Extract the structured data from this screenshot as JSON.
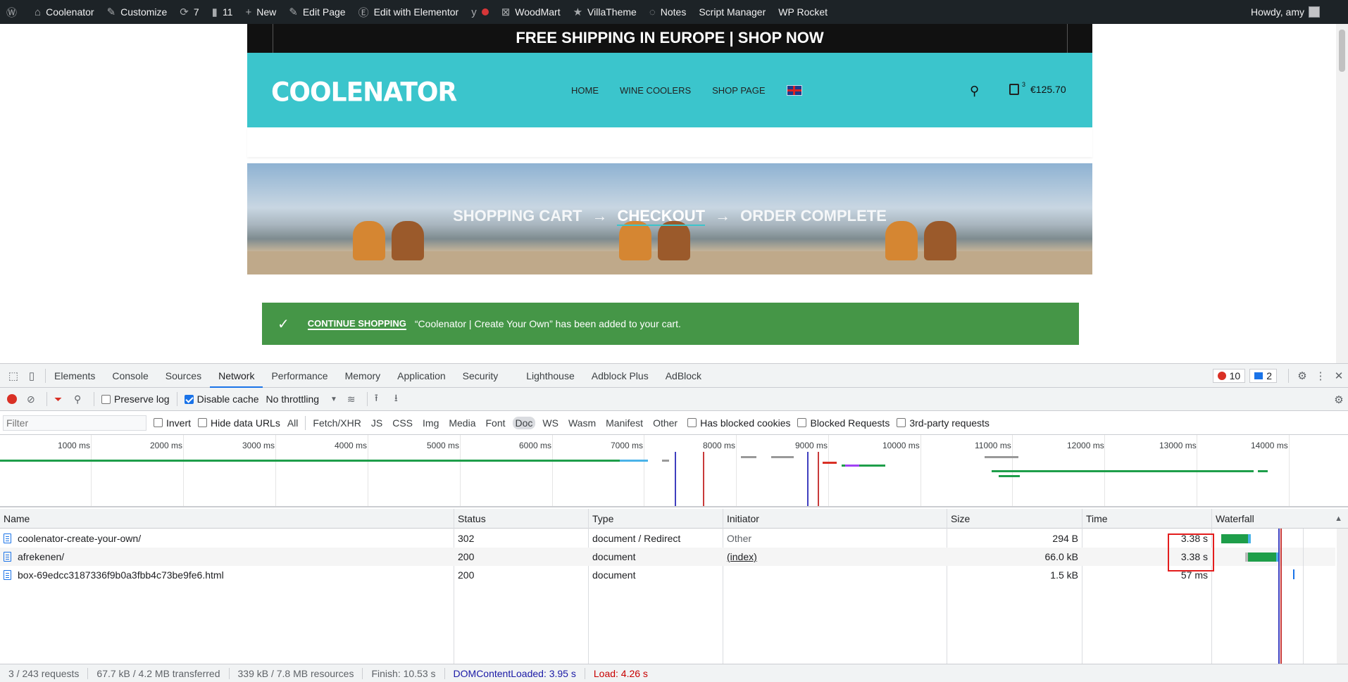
{
  "wp_bar": {
    "site_name": "Coolenator",
    "customize": "Customize",
    "updates": "7",
    "comments": "11",
    "new": "New",
    "edit_page": "Edit Page",
    "edit_elementor": "Edit with Elementor",
    "woodmart": "WoodMart",
    "villatheme": "VillaTheme",
    "notes": "Notes",
    "script_manager": "Script Manager",
    "wp_rocket": "WP Rocket",
    "howdy": "Howdy, amy"
  },
  "site": {
    "promo": "FREE SHIPPING IN EUROPE | SHOP NOW",
    "logo": "COOLENATOR",
    "nav": [
      "HOME",
      "WINE COOLERS",
      "SHOP PAGE"
    ],
    "cart_count": "3",
    "cart_total": "€125.70",
    "breadcrumbs": [
      "SHOPPING CART",
      "CHECKOUT",
      "ORDER COMPLETE"
    ],
    "notice_link": "CONTINUE SHOPPING",
    "notice_text": "“Coolenator | Create Your Own” has been added to your cart."
  },
  "devtools": {
    "tabs": [
      "Elements",
      "Console",
      "Sources",
      "Network",
      "Performance",
      "Memory",
      "Application",
      "Security",
      "Lighthouse",
      "Adblock Plus",
      "AdBlock"
    ],
    "active_tab": "Network",
    "errors": "10",
    "messages": "2",
    "toolbar": {
      "preserve_log": "Preserve log",
      "disable_cache": "Disable cache",
      "throttling": "No throttling"
    },
    "filter": {
      "placeholder": "Filter",
      "invert": "Invert",
      "hide_data_urls": "Hide data URLs",
      "types": [
        "All",
        "Fetch/XHR",
        "JS",
        "CSS",
        "Img",
        "Media",
        "Font",
        "Doc",
        "WS",
        "Wasm",
        "Manifest",
        "Other"
      ],
      "selected_type": "Doc",
      "has_blocked_cookies": "Has blocked cookies",
      "blocked_requests": "Blocked Requests",
      "third_party": "3rd-party requests"
    },
    "overview_ticks": [
      "1000 ms",
      "2000 ms",
      "3000 ms",
      "4000 ms",
      "5000 ms",
      "6000 ms",
      "7000 ms",
      "8000 ms",
      "9000 ms",
      "10000 ms",
      "11000 ms",
      "12000 ms",
      "13000 ms",
      "14000 ms"
    ],
    "columns": [
      "Name",
      "Status",
      "Type",
      "Initiator",
      "Size",
      "Time",
      "Waterfall"
    ],
    "rows": [
      {
        "name": "coolenator-create-your-own/",
        "status": "302",
        "type": "document / Redirect",
        "initiator": "Other",
        "size": "294 B",
        "time": "3.38 s"
      },
      {
        "name": "afrekenen/",
        "status": "200",
        "type": "document",
        "initiator": "(index)",
        "size": "66.0 kB",
        "time": "3.38 s"
      },
      {
        "name": "box-69edcc3187336f9b0a3fbb4c73be9fe6.html",
        "status": "200",
        "type": "document",
        "initiator": "",
        "size": "1.5 kB",
        "time": "57 ms"
      }
    ],
    "status": {
      "requests": "3 / 243 requests",
      "transferred": "67.7 kB / 4.2 MB transferred",
      "resources": "339 kB / 7.8 MB resources",
      "finish": "Finish: 10.53 s",
      "dcl": "DOMContentLoaded: 3.95 s",
      "load": "Load: 4.26 s"
    },
    "colors": {
      "accent": "#1a73e8",
      "error": "#d93025",
      "bar_green": "#0f9d58",
      "highlight": "#e31d1d"
    }
  }
}
